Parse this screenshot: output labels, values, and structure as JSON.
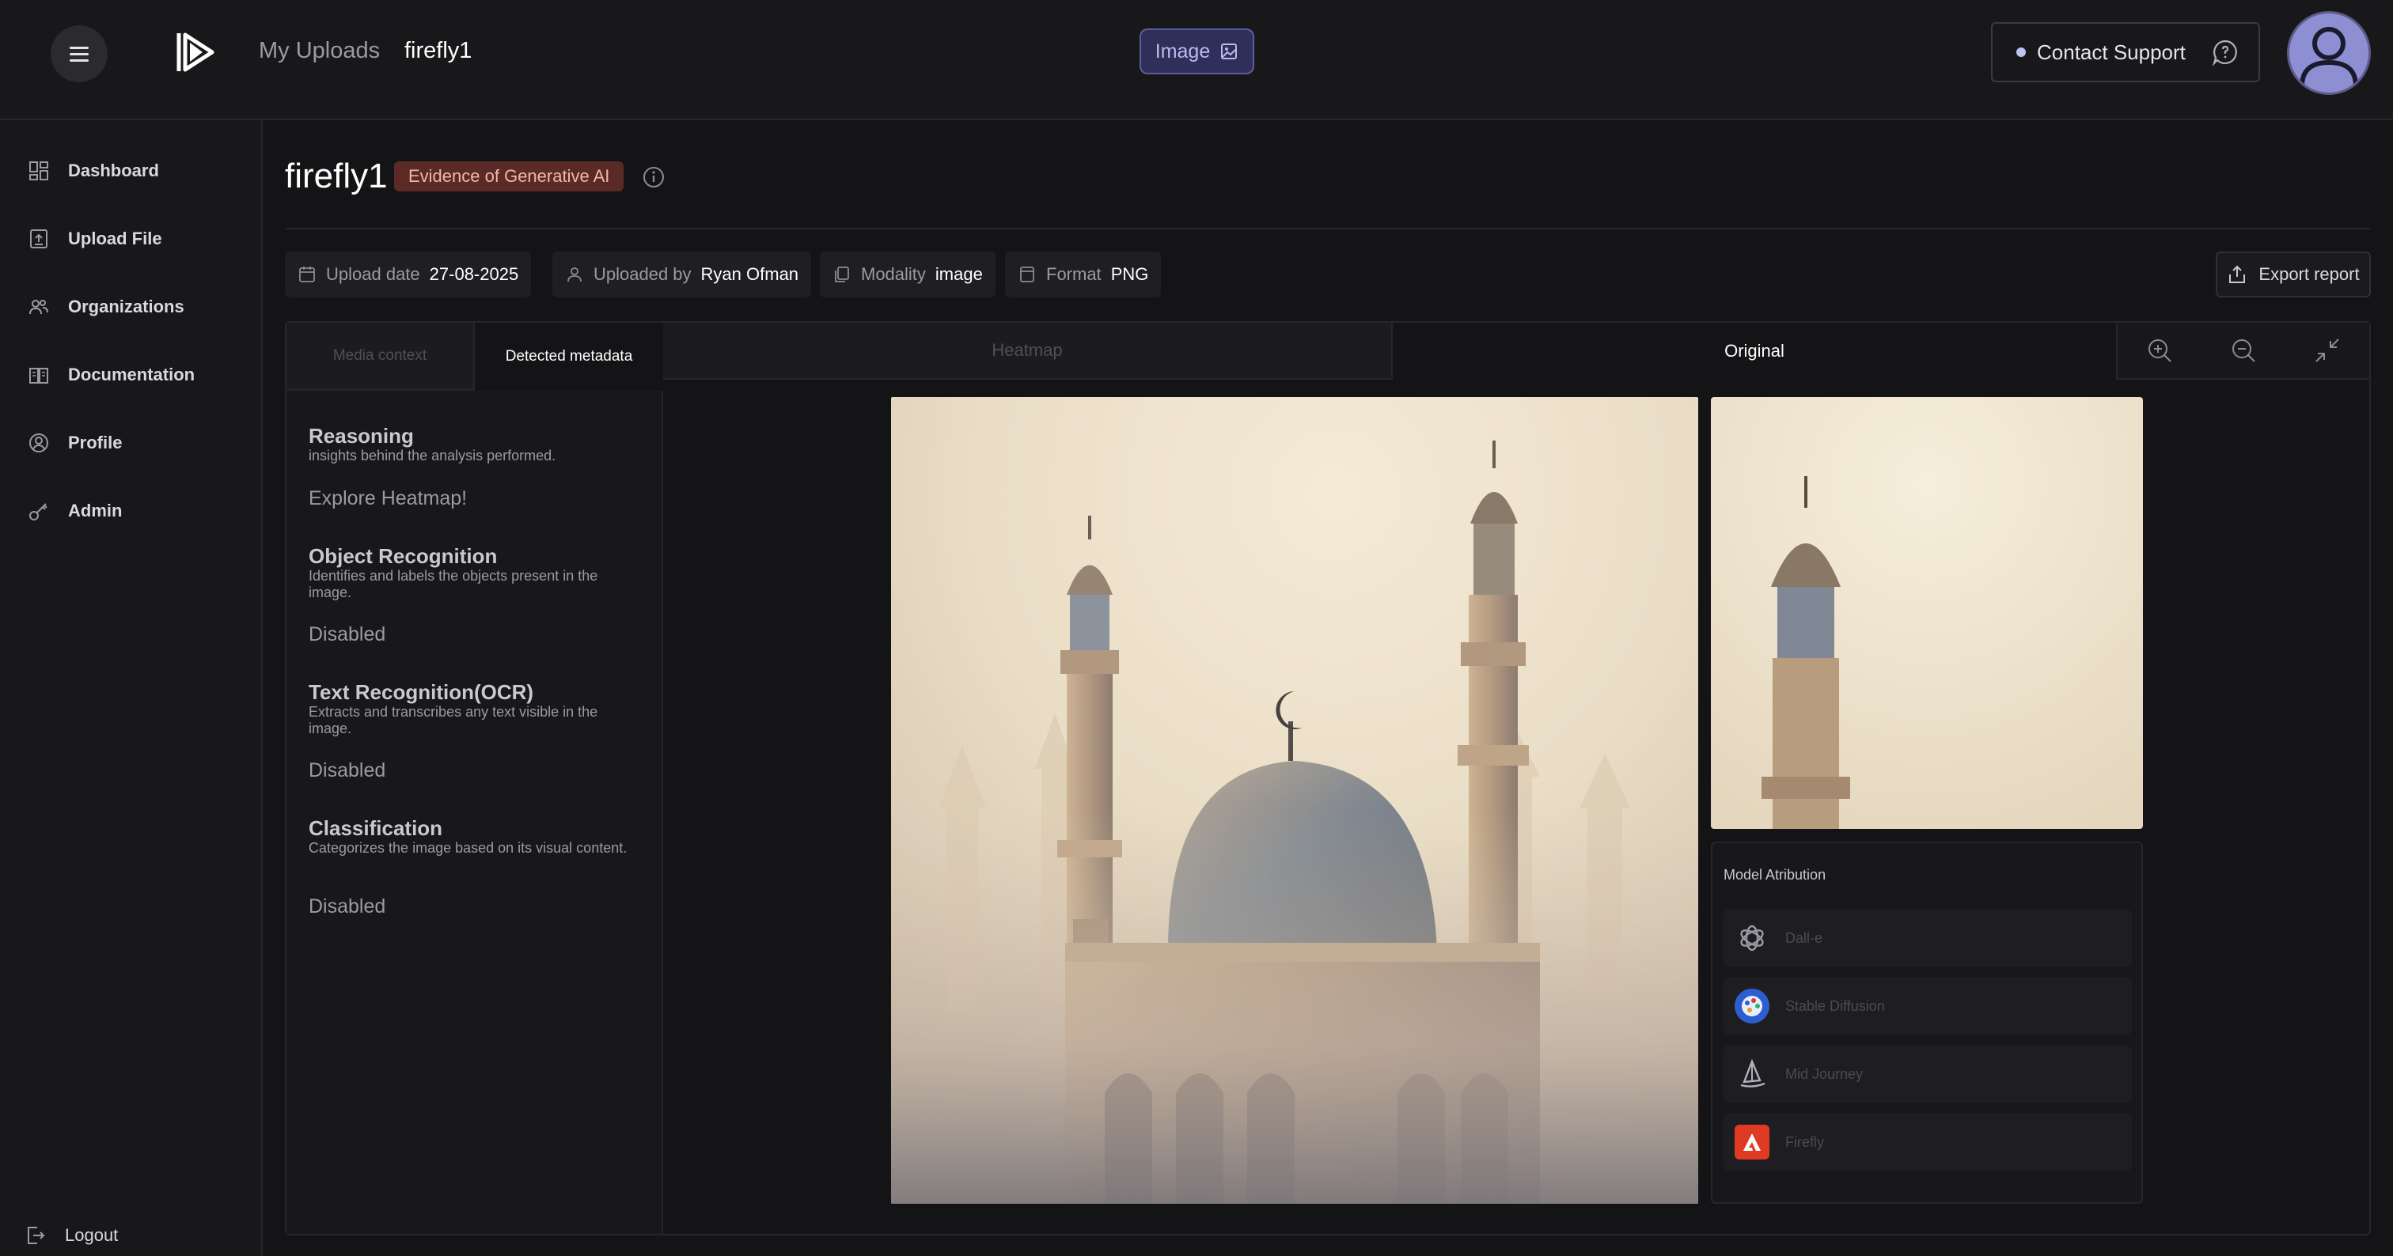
{
  "header": {
    "breadcrumb_root": "My Uploads",
    "breadcrumb_current": "firefly1",
    "media_type_label": "Image",
    "support_label": "Contact Support"
  },
  "sidebar": {
    "items": [
      {
        "label": "Dashboard",
        "icon": "grid-icon"
      },
      {
        "label": "Upload File",
        "icon": "upload-file-icon"
      },
      {
        "label": "Organizations",
        "icon": "users-icon"
      },
      {
        "label": "Documentation",
        "icon": "book-icon"
      },
      {
        "label": "Profile",
        "icon": "user-circle-icon"
      },
      {
        "label": "Admin",
        "icon": "key-icon"
      }
    ],
    "logout_label": "Logout"
  },
  "page": {
    "title": "firefly1",
    "badge": "Evidence of Generative AI",
    "meta": {
      "upload_date_label": "Upload date",
      "upload_date": "27-08-2025",
      "uploaded_by_label": "Uploaded by",
      "uploaded_by": "Ryan Ofman",
      "modality_label": "Modality",
      "modality": "image",
      "format_label": "Format",
      "format": "PNG"
    },
    "export_label": "Export report"
  },
  "left_panel": {
    "tabs": [
      "Media context",
      "Detected metadata"
    ],
    "active_tab": "Detected metadata",
    "sections": [
      {
        "title": "Reasoning",
        "desc": "insights behind the analysis performed.",
        "value": "Explore Heatmap!"
      },
      {
        "title": "Object Recognition",
        "desc": "Identifies and labels the objects present in the image.",
        "value": "Disabled"
      },
      {
        "title": "Text Recognition(OCR)",
        "desc": "Extracts and transcribes any text visible in the image.",
        "value": "Disabled"
      },
      {
        "title": "Classification",
        "desc": "Categorizes the image based on its visual content.",
        "value": "Disabled"
      }
    ]
  },
  "viewer": {
    "tabs": [
      "Heatmap",
      "Original"
    ],
    "active_tab": "Original",
    "attribution_title": "Model Atribution",
    "models": [
      {
        "name": "Dall-e",
        "icon": "openai-icon"
      },
      {
        "name": "Stable Diffusion",
        "icon": "stable-diffusion-icon"
      },
      {
        "name": "Mid Journey",
        "icon": "midjourney-sail-icon"
      },
      {
        "name": "Firefly",
        "icon": "adobe-firefly-icon"
      }
    ]
  },
  "colors": {
    "background": "#141417",
    "panel": "#18181b",
    "accent": "#5b5d9c",
    "badge_bg": "#5a2b26",
    "badge_text": "#f3b5a8"
  }
}
